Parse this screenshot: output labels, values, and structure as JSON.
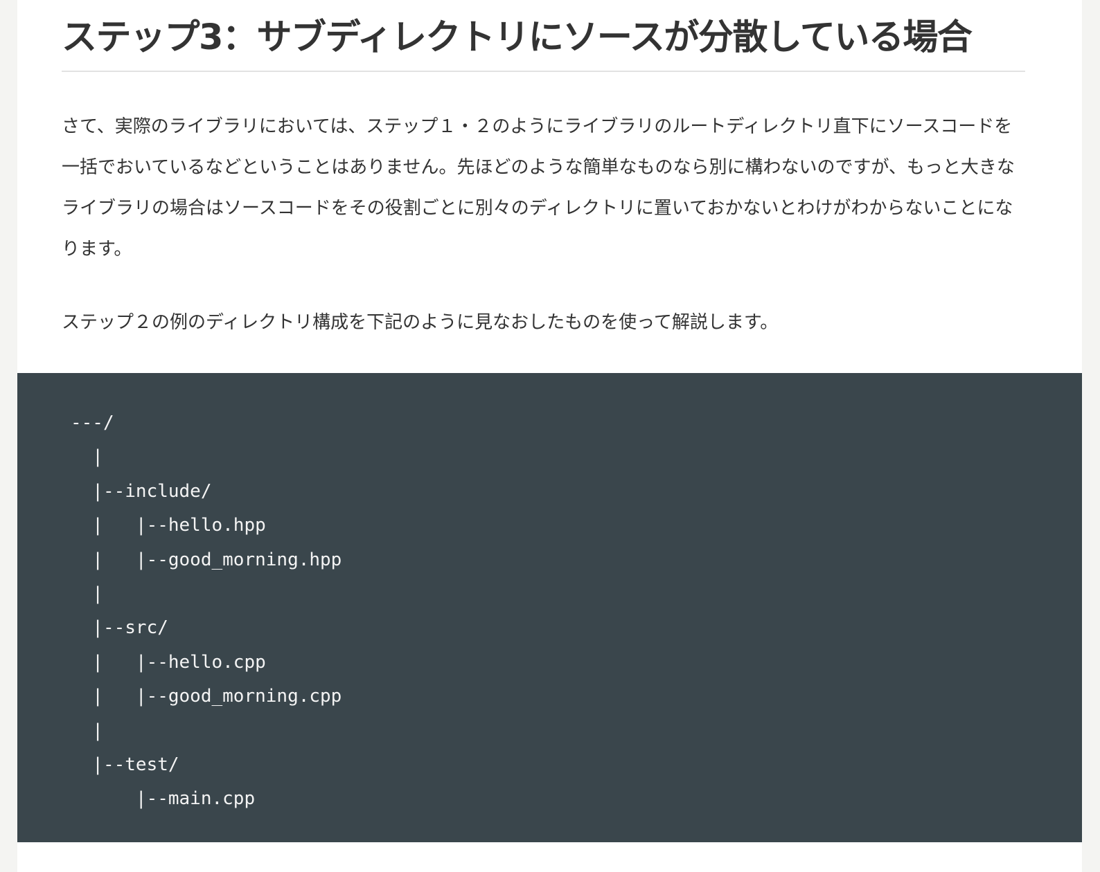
{
  "article": {
    "heading": "ステップ3：サブディレクトリにソースが分散している場合",
    "paragraph_1": "さて、実際のライブラリにおいては、ステップ１・２のようにライブラリのルートディレクトリ直下にソースコードを一括でおいているなどということはありません。先ほどのような簡単なものなら別に構わないのですが、もっと大きなライブラリの場合はソースコードをその役割ごとに別々のディレクトリに置いておかないとわけがわからないことになります。",
    "paragraph_2": "ステップ２の例のディレクトリ構成を下記のように見なおしたものを使って解説します。"
  },
  "code_block": {
    "lines": [
      "---/",
      "  |",
      "  |--include/",
      "  |   |--hello.hpp",
      "  |   |--good_morning.hpp",
      "  |",
      "  |--src/",
      "  |   |--hello.cpp",
      "  |   |--good_morning.cpp",
      "  |",
      "  |--test/",
      "      |--main.cpp"
    ]
  }
}
